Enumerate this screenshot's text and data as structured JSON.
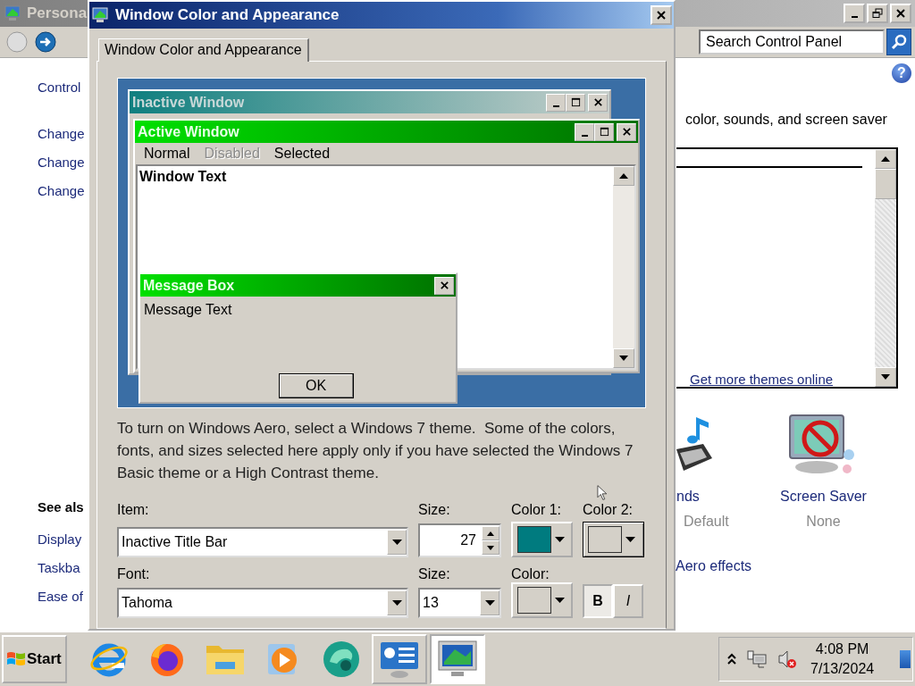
{
  "personalization_window": {
    "title": "Persona",
    "search_placeholder": "Search Control Panel",
    "help": "?",
    "nav_links": [
      "Control",
      "Change",
      "Change",
      "Change"
    ],
    "see_also_heading": "See als",
    "see_also_links": [
      "Display",
      "Taskba",
      "Ease of"
    ],
    "description": "color, sounds, and screen saver",
    "theme_link": "Get more themes online",
    "settings": [
      {
        "kind": "sounds",
        "label": "nds",
        "value": "Default"
      },
      {
        "kind": "screensaver",
        "label": "Screen Saver",
        "value": "None"
      }
    ],
    "aero_link": "Aero effects"
  },
  "dialog": {
    "title": "Window Color and Appearance",
    "tabs": [
      {
        "label": "Window Color and Appearance",
        "selected": true
      }
    ],
    "preview": {
      "inactive_window": {
        "title": "Inactive Window"
      },
      "active_window": {
        "title": "Active Window",
        "text": "Window Text",
        "menu": [
          {
            "label": "Normal",
            "disabled": false
          },
          {
            "label": "Disabled",
            "disabled": true
          },
          {
            "label": "Selected",
            "disabled": false
          }
        ]
      },
      "message_box": {
        "title": "Message Box",
        "text": "Message Text",
        "button": "OK"
      }
    },
    "note": "To turn on Windows Aero, select a Windows 7 theme.  Some of the colors, fonts, and sizes selected here apply only if you have selected the Windows 7 Basic theme or a High Contrast theme.",
    "item": {
      "label": "Item:",
      "value": "Inactive Title Bar"
    },
    "item_size": {
      "label": "Size:",
      "value": "27"
    },
    "color1": {
      "label": "Color 1:",
      "color": "#007b7f"
    },
    "color2": {
      "label": "Color 2:",
      "color": "#d4d0c8"
    },
    "font": {
      "label": "Font:",
      "value": "Tahoma"
    },
    "font_size": {
      "label": "Size:",
      "value": "13"
    },
    "font_color": {
      "label": "Color:",
      "color": "#d4d0c8"
    },
    "bold": {
      "label": "B",
      "selected": true
    },
    "italic": {
      "label": "I",
      "selected": false
    }
  },
  "taskbar": {
    "start": "Start",
    "apps": [
      {
        "kind": "browser-e",
        "selected": false,
        "running": false
      },
      {
        "kind": "fox",
        "selected": false,
        "running": false
      },
      {
        "kind": "folder",
        "selected": false,
        "running": false
      },
      {
        "kind": "player",
        "selected": false,
        "running": false
      },
      {
        "kind": "swirl",
        "selected": false,
        "running": false
      },
      {
        "kind": "panel",
        "selected": false,
        "running": true
      },
      {
        "kind": "monitor",
        "selected": true,
        "running": true
      }
    ],
    "time": "4:08 PM",
    "date": "7/13/2024"
  }
}
